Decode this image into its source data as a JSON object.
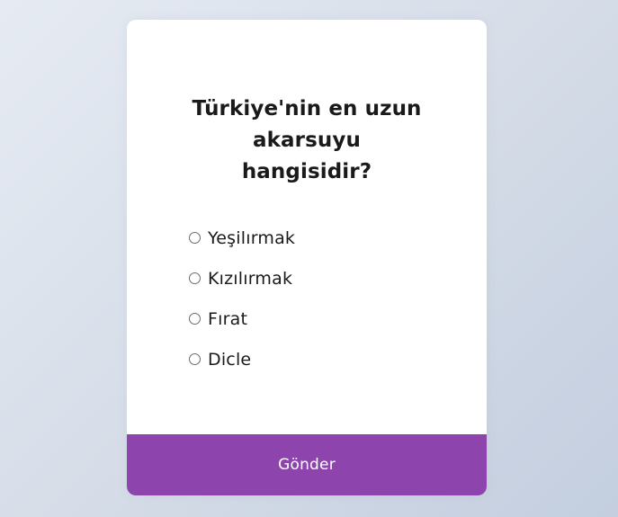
{
  "quiz": {
    "question_line1": "Türkiye'nin en uzun",
    "question_line2": "akarsuyu",
    "question_line3": "hangisidir?",
    "answers": [
      {
        "label": "Yeşilırmak",
        "selected": false
      },
      {
        "label": "Kızılırmak",
        "selected": false
      },
      {
        "label": "Fırat",
        "selected": false
      },
      {
        "label": "Dicle",
        "selected": false
      }
    ],
    "submit_label": "Gönder"
  },
  "colors": {
    "accent": "#8e44ad",
    "card_background": "#ffffff",
    "page_gradient_start": "#e6ebf3",
    "page_gradient_end": "#c3cedf"
  }
}
